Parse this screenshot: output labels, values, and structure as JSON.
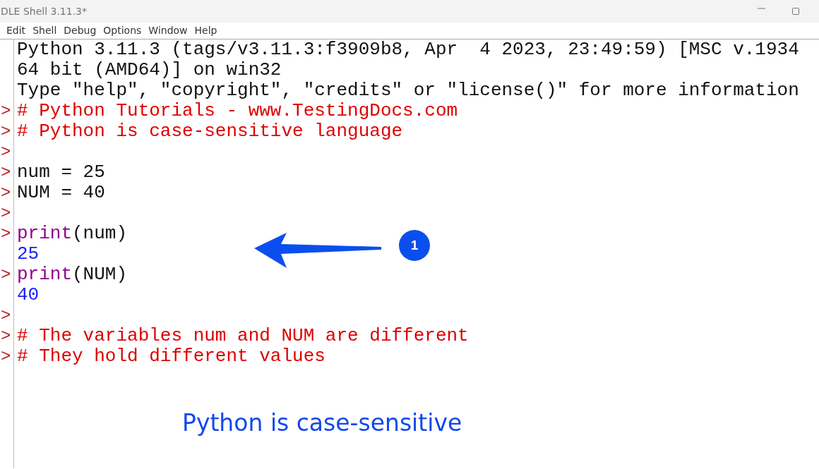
{
  "window": {
    "title": "DLE Shell 3.11.3*"
  },
  "menu": [
    "Edit",
    "Shell",
    "Debug",
    "Options",
    "Window",
    "Help"
  ],
  "lines": [
    {
      "prompt": false,
      "segments": [
        {
          "kind": "output",
          "text": "Python 3.11.3 (tags/v3.11.3:f3909b8, Apr  4 2023, 23:49:59) [MSC v.1934"
        }
      ]
    },
    {
      "prompt": false,
      "segments": [
        {
          "kind": "output",
          "text": "64 bit (AMD64)] on win32"
        }
      ]
    },
    {
      "prompt": false,
      "segments": [
        {
          "kind": "output",
          "text": "Type \"help\", \"copyright\", \"credits\" or \"license()\" for more information"
        }
      ]
    },
    {
      "prompt": true,
      "prompt_text": ">",
      "segments": [
        {
          "kind": "comment",
          "text": "# Python Tutorials - www.TestingDocs.com"
        }
      ]
    },
    {
      "prompt": true,
      "prompt_text": ">",
      "segments": [
        {
          "kind": "comment",
          "text": "# Python is case-sensitive language"
        }
      ]
    },
    {
      "prompt": true,
      "prompt_text": ">"
    },
    {
      "prompt": true,
      "prompt_text": ">",
      "segments": [
        {
          "kind": "code",
          "text": "num = 25"
        }
      ]
    },
    {
      "prompt": true,
      "prompt_text": ">",
      "segments": [
        {
          "kind": "code",
          "text": "NUM = 40"
        }
      ]
    },
    {
      "prompt": true,
      "prompt_text": ">"
    },
    {
      "prompt": true,
      "prompt_text": ">",
      "segments": [
        {
          "kind": "builtin",
          "text": "print"
        },
        {
          "kind": "code",
          "text": "(num)"
        }
      ]
    },
    {
      "prompt": false,
      "segments": [
        {
          "kind": "result",
          "text": "25"
        }
      ]
    },
    {
      "prompt": true,
      "prompt_text": ">",
      "segments": [
        {
          "kind": "builtin",
          "text": "print"
        },
        {
          "kind": "code",
          "text": "(NUM)"
        }
      ]
    },
    {
      "prompt": false,
      "segments": [
        {
          "kind": "result",
          "text": "40"
        }
      ]
    },
    {
      "prompt": true,
      "prompt_text": ">"
    },
    {
      "prompt": true,
      "prompt_text": ">",
      "segments": [
        {
          "kind": "comment",
          "text": "# The variables num and NUM are different"
        }
      ]
    },
    {
      "prompt": true,
      "prompt_text": ">",
      "segments": [
        {
          "kind": "comment",
          "text": "# They hold different values"
        }
      ]
    }
  ],
  "annotation": {
    "number": "1",
    "caption": "Python is case-sensitive"
  }
}
